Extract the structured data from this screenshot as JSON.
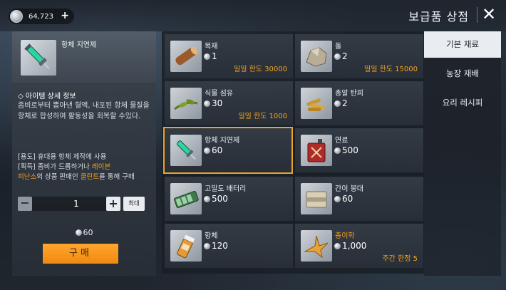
{
  "header": {
    "currency_value": "64,723",
    "currency_plus": "+",
    "title": "보급품 상점",
    "close_glyph": "✕"
  },
  "detail": {
    "name": "항체 지연제",
    "section_title": "◇ 아이템 상세 정보",
    "description": "좀비로부터 뽑아낸 혈액, 내포된 항체 물질을 항체로 합성하여 활동성을 회복할 수있다.",
    "usage_line": "[용도] 휴대용 항체 제작에 사용",
    "obtain_prefix": "[획득] 좀비가 드롭하거나 ",
    "obtain_place_a": "레이븐",
    "obtain_place_b": "피난소",
    "obtain_mid": "의 상품 판매인 ",
    "obtain_npc": "클린트",
    "obtain_suffix": "를 통해 구매",
    "quantity": "1",
    "minus_label": "−",
    "plus_label": "+",
    "max_label": "최대",
    "total_price": "60",
    "buy_label": "구매"
  },
  "items": [
    {
      "name": "목재",
      "price": "1",
      "limit": "일일 한도 30000",
      "icon": "wood-log-icon"
    },
    {
      "name": "돌",
      "price": "2",
      "limit": "일일 한도 15000",
      "icon": "stone-icon"
    },
    {
      "name": "식물 섬유",
      "price": "30",
      "limit": "일일 한도 1000",
      "icon": "plant-fiber-icon"
    },
    {
      "name": "총알 탄피",
      "price": "2",
      "limit": "",
      "icon": "bullet-casing-icon"
    },
    {
      "name": "항체 지연제",
      "price": "60",
      "limit": "",
      "icon": "syringe-icon"
    },
    {
      "name": "연료",
      "price": "500",
      "limit": "",
      "icon": "fuel-can-icon"
    },
    {
      "name": "고밀도 배터리",
      "price": "500",
      "limit": "",
      "icon": "battery-pack-icon"
    },
    {
      "name": "간이 붕대",
      "price": "60",
      "limit": "",
      "icon": "bandage-icon"
    },
    {
      "name": "항체",
      "price": "120",
      "limit": "",
      "icon": "antibody-bottle-icon"
    },
    {
      "name": "종이학",
      "price": "1,000",
      "limit": "주간 한정 5",
      "icon": "paper-crane-icon"
    }
  ],
  "tabs": [
    {
      "label": "기본 재료"
    },
    {
      "label": "농장 재배"
    },
    {
      "label": "요리 레시피"
    }
  ],
  "colors": {
    "accent_orange": "#f6a21c",
    "selected_border": "#e9a326",
    "buy_button": "#f39a1f"
  }
}
